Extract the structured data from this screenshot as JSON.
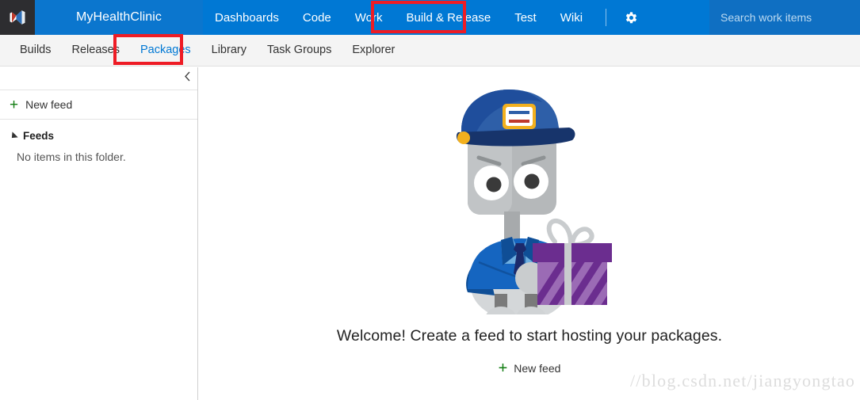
{
  "topnav": {
    "logo_icon": "visual-studio-logo-icon",
    "project_name": "MyHealthClinic",
    "items": [
      {
        "label": "Dashboards",
        "icon": "dashboards-icon"
      },
      {
        "label": "Code",
        "icon": "code-icon"
      },
      {
        "label": "Work",
        "icon": "work-icon"
      },
      {
        "label": "Build & Release",
        "icon": "build-release-icon"
      },
      {
        "label": "Test",
        "icon": "test-icon"
      },
      {
        "label": "Wiki",
        "icon": "wiki-icon"
      }
    ],
    "settings_icon": "gear-icon",
    "active_item": "Build & Release",
    "background_color": "#0078D4",
    "project_background_color": "#0B76CE"
  },
  "search": {
    "placeholder": "Search work items",
    "value": "",
    "icon": "search-icon",
    "background_color": "#0F6FC2"
  },
  "subnav": {
    "items": [
      {
        "label": "Builds"
      },
      {
        "label": "Releases"
      },
      {
        "label": "Packages"
      },
      {
        "label": "Library"
      },
      {
        "label": "Task Groups"
      },
      {
        "label": "Explorer"
      }
    ],
    "active_item": "Packages",
    "active_color": "#0078D4",
    "background_color": "#F4F4F4"
  },
  "sidebar": {
    "collapse_icon": "chevron-left-icon",
    "new_feed": {
      "label": "New feed",
      "icon": "plus-icon"
    },
    "feeds_group": {
      "label": "Feeds",
      "expand_icon": "triangle-expanded-icon",
      "empty_message": "No items in this folder."
    }
  },
  "main": {
    "illustration": "robot-doorman-with-gift-illustration",
    "welcome_text": "Welcome! Create a feed to start hosting your packages.",
    "new_feed": {
      "label": "New feed",
      "icon": "plus-icon"
    }
  },
  "annotations": {
    "color": "#EE1C25",
    "boxes": [
      {
        "target": "Build & Release"
      },
      {
        "target": "Packages"
      }
    ]
  },
  "watermark": {
    "text": "//blog.csdn.net/jiangyongtao"
  },
  "illustration_colors": {
    "cap_dark": "#1F4E9C",
    "cap_mid": "#2E5FA8",
    "cap_brim": "#17346B",
    "cap_button": "#F2B01E",
    "head_gray": "#B5B8BA",
    "head_light": "#C9CCCE",
    "eye_white": "#FFFFFF",
    "eye_pupil": "#3A3A3A",
    "suit_blue": "#1565C0",
    "suit_blue_dark": "#0F4E96",
    "shirt_blue": "#6FAFE0",
    "tie_navy": "#1B2A6B",
    "body_light": "#D4D7D9",
    "leg_gray": "#7A7A7A",
    "foot_gray": "#D0D3D5",
    "gift_lid": "#6B2D8F",
    "gift_light": "#9B6BB5",
    "gift_dark": "#6B2D8F",
    "ribbon_gray": "#C9CCCE"
  }
}
